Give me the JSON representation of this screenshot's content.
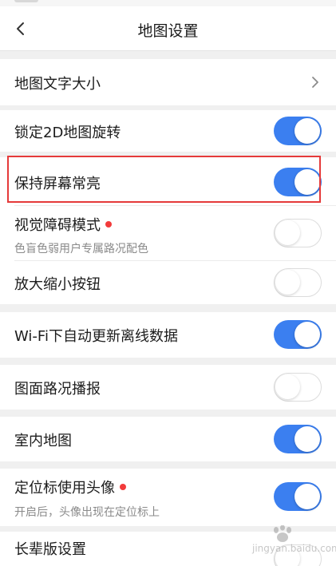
{
  "header": {
    "title": "地图设置"
  },
  "settings": [
    {
      "label": "地图文字大小",
      "control": "chevron"
    },
    {
      "label": "锁定2D地图旋转",
      "control": "toggle",
      "on": true
    },
    {
      "label": "保持屏幕常亮",
      "control": "toggle",
      "on": true,
      "highlighted": true
    },
    {
      "label": "视觉障碍模式",
      "control": "toggle",
      "on": false,
      "new_dot": true,
      "sub": "色盲色弱用户专属路况配色"
    },
    {
      "label": "放大缩小按钮",
      "control": "toggle",
      "on": false
    },
    {
      "label": "Wi-Fi下自动更新离线数据",
      "control": "toggle",
      "on": true
    },
    {
      "label": "图面路况播报",
      "control": "toggle",
      "on": false
    },
    {
      "label": "室内地图",
      "control": "toggle",
      "on": true
    },
    {
      "label": "定位标使用头像",
      "control": "toggle",
      "on": true,
      "new_dot": true,
      "sub": "开启后，头像出现在定位标上"
    },
    {
      "label": "长辈版设置",
      "control": "toggle",
      "on": false
    }
  ],
  "colors": {
    "accent": "#3b7ff0",
    "dot": "#f23b3b",
    "highlight_border": "#e53a3a"
  },
  "watermark": {
    "text": "jingyan.baidu.com"
  }
}
